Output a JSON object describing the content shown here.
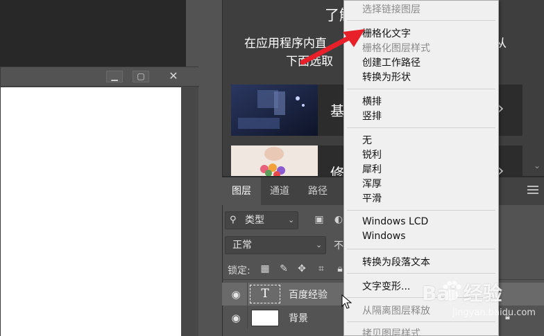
{
  "learn_panel": {
    "title": "了解",
    "desc_line1": "在应用程序内直",
    "desc_line1_tail": "从",
    "desc_line2": "下面选取",
    "cards": [
      {
        "label": "基"
      },
      {
        "label": "修"
      }
    ]
  },
  "layers_panel": {
    "tabs": [
      {
        "label": "图层",
        "active": true
      },
      {
        "label": "通道",
        "active": false
      },
      {
        "label": "路径",
        "active": false
      }
    ],
    "filter_kind": "类型",
    "blend_mode": "正常",
    "opacity_label": "不",
    "lock_label": "锁定:",
    "layers": [
      {
        "name": "百度经验",
        "type": "text",
        "thumb_glyph": "T",
        "selected": true
      },
      {
        "name": "背景",
        "type": "image",
        "selected": false
      }
    ]
  },
  "context_menu": {
    "items": [
      {
        "label": "选择链接图层",
        "disabled": true
      },
      {
        "label": "栅格化文字",
        "disabled": false
      },
      {
        "label": "栅格化图层样式",
        "disabled": true
      },
      {
        "label": "创建工作路径",
        "disabled": false
      },
      {
        "label": "转换为形状",
        "disabled": false
      },
      {
        "label": "横排",
        "disabled": false
      },
      {
        "label": "竖排",
        "disabled": false
      },
      {
        "label": "无",
        "disabled": false
      },
      {
        "label": "锐利",
        "disabled": false
      },
      {
        "label": "犀利",
        "disabled": false
      },
      {
        "label": "浑厚",
        "disabled": false
      },
      {
        "label": "平滑",
        "disabled": false
      },
      {
        "label": "Windows LCD",
        "disabled": false
      },
      {
        "label": "Windows",
        "disabled": false
      },
      {
        "label": "转换为段落文本",
        "disabled": false
      },
      {
        "label": "文字变形...",
        "disabled": false
      },
      {
        "label": "从隔离图层释放",
        "disabled": true
      },
      {
        "label": "拷贝图层样式",
        "disabled": true
      }
    ]
  },
  "watermark": {
    "logo": "Bai 经验",
    "url": "jingyan.baidu.com"
  },
  "colors": {
    "menu_bg": "#f0f0f0",
    "panel_dark": "#3e3e3e",
    "panel_mid": "#535353",
    "accent_red": "#e8202a"
  }
}
